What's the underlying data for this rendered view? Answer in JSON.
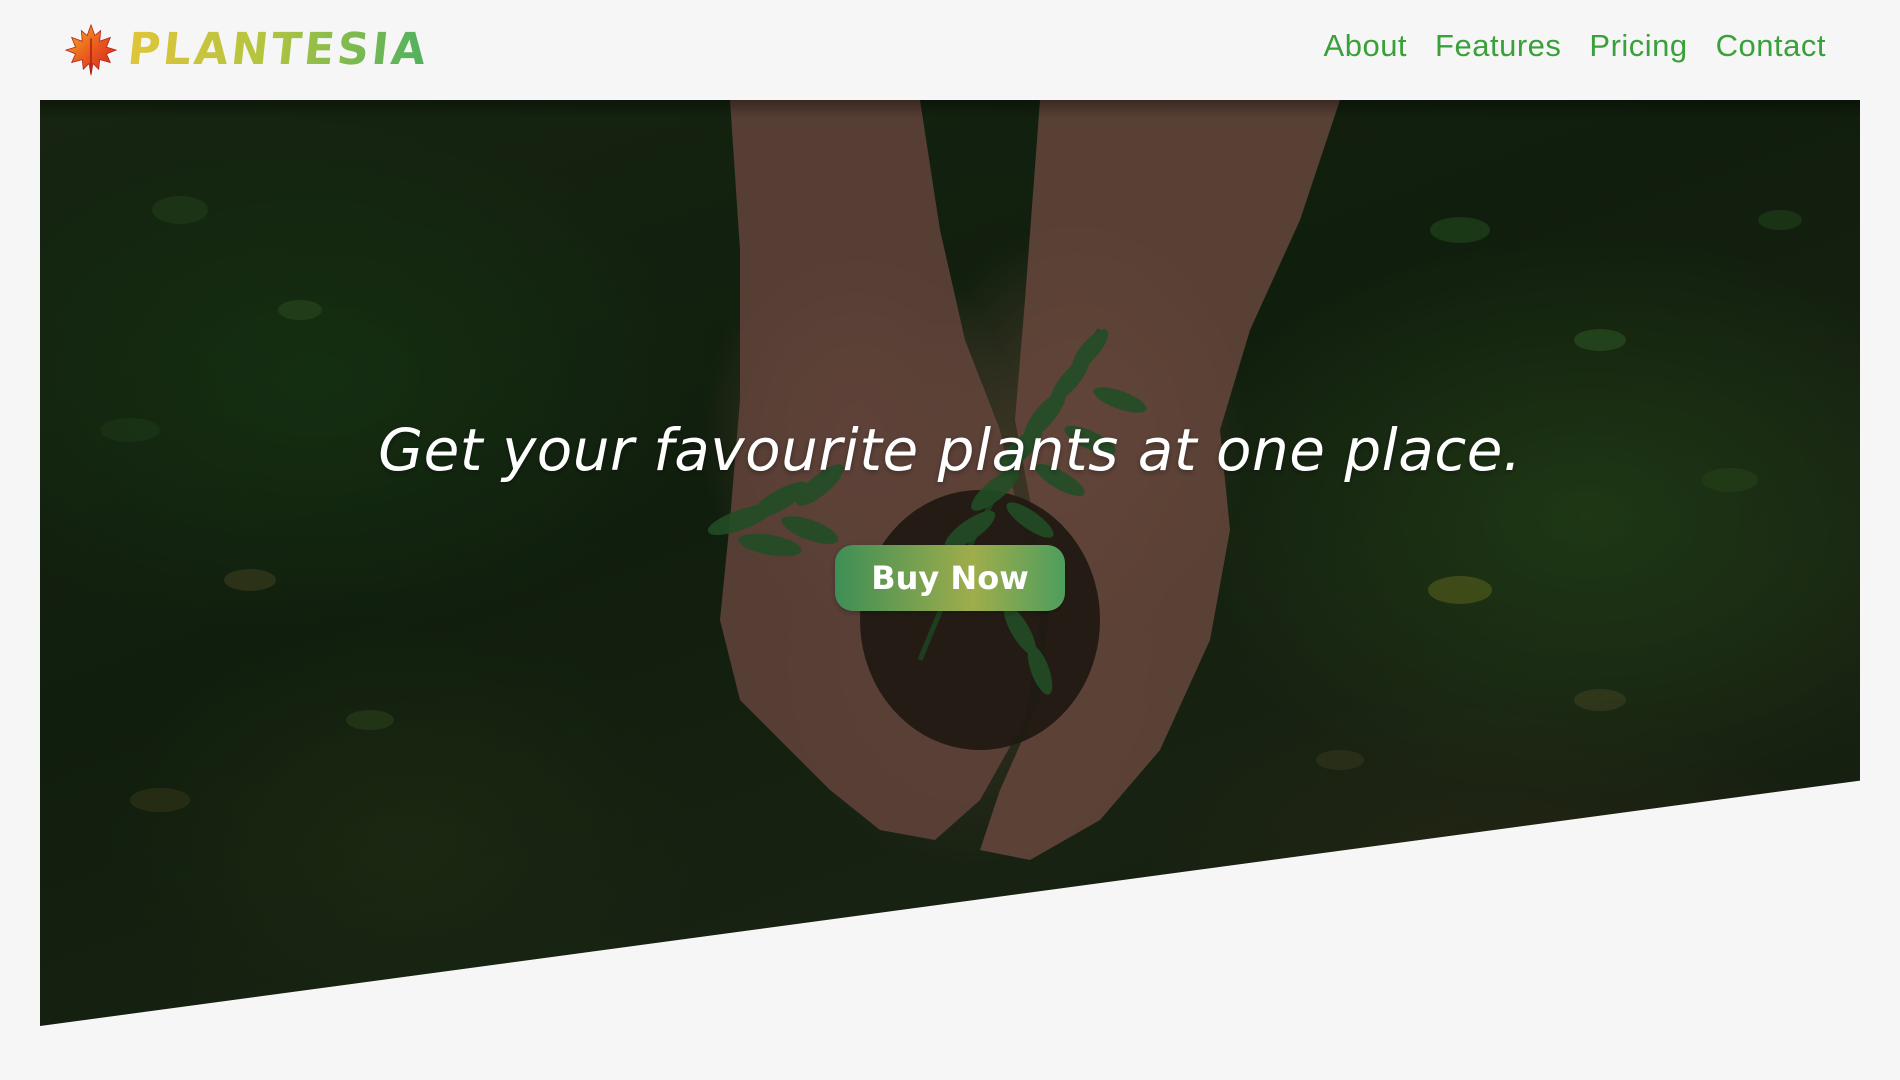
{
  "brand": {
    "name": "PLANTESIA",
    "logo_icon": "maple-leaf-icon"
  },
  "nav": {
    "items": [
      {
        "label": "About"
      },
      {
        "label": "Features"
      },
      {
        "label": "Pricing"
      },
      {
        "label": "Contact"
      }
    ]
  },
  "hero": {
    "headline": "Get your favourite plants at one place.",
    "cta_label": "Buy Now",
    "image_subject": "hands-holding-seedling-soil"
  },
  "colors": {
    "page_background": "#f6f6f6",
    "nav_link": "#3aa03a",
    "brand_gradient_start": "#e0c53a",
    "brand_gradient_end": "#4fb15f",
    "cta_gradient_start": "#3e8e56",
    "cta_gradient_mid": "#9fad4b",
    "hero_text": "#ffffff"
  }
}
